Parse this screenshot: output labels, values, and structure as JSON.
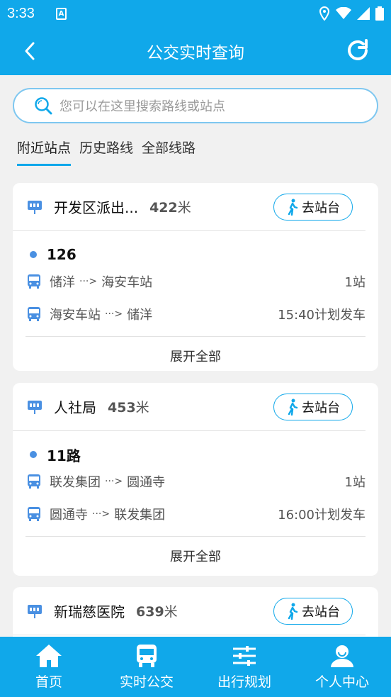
{
  "status_bar": {
    "time": "3:33",
    "notification_icon": "a-icon"
  },
  "app_bar": {
    "title": "公交实时查询",
    "back_icon": "chevron-left-icon",
    "refresh_icon": "refresh-icon"
  },
  "search": {
    "placeholder": "您可以在这里搜索路线或站点"
  },
  "tabs": [
    {
      "label": "附近站点",
      "active": true
    },
    {
      "label": "历史路线",
      "active": false
    },
    {
      "label": "全部线路",
      "active": false
    }
  ],
  "go_label": "去站台",
  "expand_label": "展开全部",
  "stops": [
    {
      "name": "开发区派出...",
      "distance": "422",
      "unit": "米",
      "route": "126",
      "directions": [
        {
          "from": "储洋",
          "to": "海安车站",
          "info": "1站"
        },
        {
          "from": "海安车站",
          "to": "储洋",
          "info": "15:40计划发车"
        }
      ]
    },
    {
      "name": "人社局",
      "distance": "453",
      "unit": "米",
      "route": "11路",
      "directions": [
        {
          "from": "联发集团",
          "to": "圆通寺",
          "info": "1站"
        },
        {
          "from": "圆通寺",
          "to": "联发集团",
          "info": "16:00计划发车"
        }
      ]
    },
    {
      "name": "新瑞慈医院",
      "distance": "639",
      "unit": "米"
    }
  ],
  "bottom_nav": [
    {
      "label": "首页",
      "icon": "home-icon"
    },
    {
      "label": "实时公交",
      "icon": "bus-icon"
    },
    {
      "label": "出行规划",
      "icon": "sliders-icon"
    },
    {
      "label": "个人中心",
      "icon": "user-icon"
    }
  ],
  "colors": {
    "primary": "#10a8ea",
    "dot": "#4a90e2",
    "background": "#f1f1f1"
  }
}
